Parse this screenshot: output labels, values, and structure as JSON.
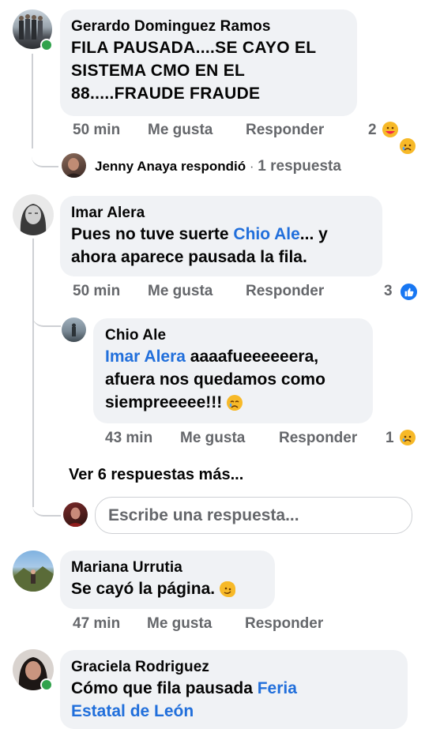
{
  "comments": [
    {
      "author": "Gerardo Dominguez Ramos",
      "line1": "FILA PAUSADA....SE CAYO EL",
      "line2": "SISTEMA CMO EN EL",
      "line3": "88.....FRAUDE FRAUDE",
      "time": "50 min",
      "like": "Me gusta",
      "reply": "Responder",
      "reaction_count": "2",
      "replies_summary": {
        "name": "Jenny Anaya",
        "verb": "respondió",
        "sep": "·",
        "count": "1 respuesta"
      }
    },
    {
      "author": "Imar Alera",
      "pre1": "Pues no tuve suerte ",
      "mention1": "Chio Ale",
      "post1": "... y",
      "line2": "ahora aparece pausada la fila.",
      "time": "50 min",
      "like": "Me gusta",
      "reply": "Responder",
      "reaction_count": "3",
      "reply_item": {
        "author": "Chio Ale",
        "mention": "Imar Alera",
        "post1": " aaaafueeeeeera,",
        "line2": "afuera nos quedamos como",
        "line3": "siempreeeee!!! ",
        "time": "43 min",
        "like": "Me gusta",
        "reply": "Responder",
        "reaction_count": "1"
      },
      "more_replies": "Ver 6 respuestas más...",
      "input_placeholder": "Escribe una respuesta..."
    },
    {
      "author": "Mariana Urrutia",
      "text": "Se cayó la página. ",
      "time": "47 min",
      "like": "Me gusta",
      "reply": "Responder"
    },
    {
      "author": "Graciela Rodriguez",
      "pre1": "Cómo que fila pausada ",
      "mention1": "Feria",
      "line2_partial": "Estatal de León"
    }
  ],
  "colors": {
    "online": "#31a24c",
    "like_blue": "#1877f2",
    "mention": "#216fdb",
    "meta": "#65676b",
    "bubble": "#f0f2f5"
  }
}
